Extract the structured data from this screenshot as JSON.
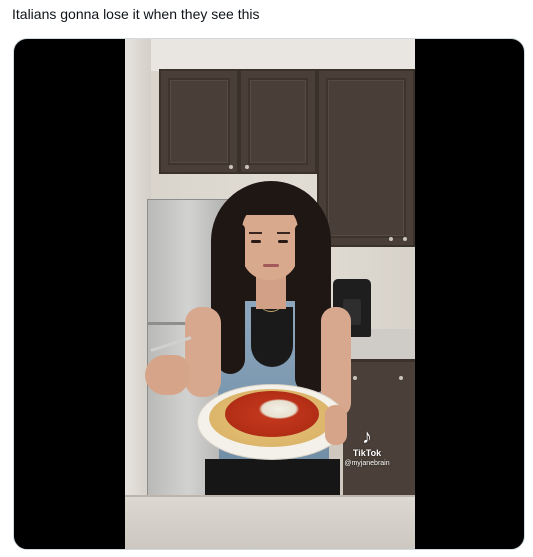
{
  "tweet": {
    "text": "Italians gonna lose it when they see this"
  },
  "video": {
    "watermark": {
      "brand": "TikTok",
      "handle": "@myjanebrain",
      "logo_icon": "tiktok-note-icon"
    }
  },
  "colors": {
    "cabinet": "#4a3f38",
    "media_background": "#000000",
    "sauce": "#c63a1f"
  }
}
